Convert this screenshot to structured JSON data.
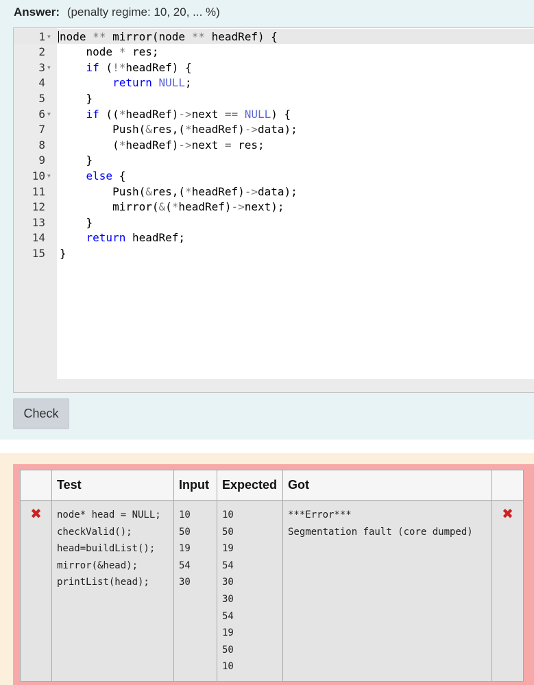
{
  "answer": {
    "label": "Answer:",
    "penalty": "(penalty regime: 10, 20, ... %)"
  },
  "editor": {
    "lines": [
      {
        "n": "1",
        "fold": true,
        "code": "node ** mirror(node ** headRef) {"
      },
      {
        "n": "2",
        "fold": false,
        "code": "    node * res;"
      },
      {
        "n": "3",
        "fold": true,
        "code": "    if (!*headRef) {"
      },
      {
        "n": "4",
        "fold": false,
        "code": "        return NULL;"
      },
      {
        "n": "5",
        "fold": false,
        "code": "    }"
      },
      {
        "n": "6",
        "fold": true,
        "code": "    if ((*headRef)->next == NULL) {"
      },
      {
        "n": "7",
        "fold": false,
        "code": "        Push(&res,(*headRef)->data);"
      },
      {
        "n": "8",
        "fold": false,
        "code": "        (*headRef)->next = res;"
      },
      {
        "n": "9",
        "fold": false,
        "code": "    }"
      },
      {
        "n": "10",
        "fold": true,
        "code": "    else {"
      },
      {
        "n": "11",
        "fold": false,
        "code": "        Push(&res,(*headRef)->data);"
      },
      {
        "n": "12",
        "fold": false,
        "code": "        mirror(&(*headRef)->next);"
      },
      {
        "n": "13",
        "fold": false,
        "code": "    }"
      },
      {
        "n": "14",
        "fold": false,
        "code": "    return headRef;"
      },
      {
        "n": "15",
        "fold": false,
        "code": "}"
      }
    ]
  },
  "check_button": {
    "label": "Check"
  },
  "results": {
    "headers": {
      "test": "Test",
      "input": "Input",
      "expected": "Expected",
      "got": "Got"
    },
    "rows": [
      {
        "status_icon": "fail-cross-icon",
        "test": "node* head = NULL;\ncheckValid();\nhead=buildList();\nmirror(&head);\nprintList(head);",
        "input": "10\n50\n19\n54\n30",
        "expected": "10\n50\n19\n54\n30\n30\n54\n19\n50\n10",
        "got": "***Error***\nSegmentation fault (core dumped)"
      }
    ]
  },
  "colors": {
    "answer_bg": "#e7f3f5",
    "results_bg": "#fcefdc",
    "fail_frame": "#f7a9a9",
    "fail_icon": "#cc2222",
    "keyword": "#0000ff",
    "constant": "#5c67d6"
  }
}
